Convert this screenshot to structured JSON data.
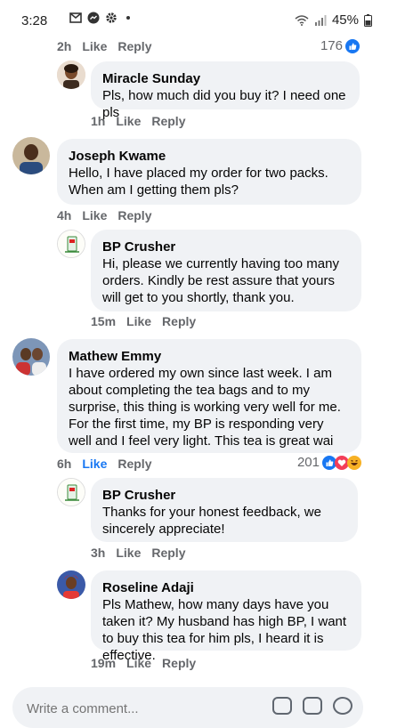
{
  "status_bar": {
    "time": "3:28",
    "battery": "45%"
  },
  "colors": {
    "like_blue": "#1877f2",
    "bubble_bg": "#f0f2f5",
    "meta_gray": "#65676b"
  },
  "reaction_icons": [
    "like-reaction-icon",
    "love-reaction-icon",
    "haha-reaction-icon"
  ],
  "comments": [
    {
      "meta": {
        "time": "2h",
        "like": "Like",
        "reply": "Reply",
        "count": "176"
      }
    },
    {
      "name": "Miracle Sunday",
      "text": "Pls, how much did you buy it? I need one pls",
      "meta": {
        "time": "1h",
        "like": "Like",
        "reply": "Reply"
      }
    },
    {
      "name": "Joseph Kwame",
      "text": "Hello, I have placed my order for two packs. When am I getting them pls?",
      "meta": {
        "time": "4h",
        "like": "Like",
        "reply": "Reply"
      }
    },
    {
      "name": "BP Crusher",
      "text": "Hi, please we currently having too many orders. Kindly be rest assure that yours will get to you shortly,  thank you.",
      "meta": {
        "time": "15m",
        "like": "Like",
        "reply": "Reply"
      }
    },
    {
      "name": "Mathew Emmy",
      "text": "I have ordered my own since last week. I am about completing the tea bags and to my surprise,  this thing is working very well for me. For the first time, my BP is responding very well and I feel very light. This tea is great wai",
      "meta": {
        "time": "6h",
        "like": "Like",
        "reply": "Reply",
        "count": "201"
      }
    },
    {
      "name": "BP Crusher",
      "text": "Thanks for your honest feedback,  we sincerely appreciate!",
      "meta": {
        "time": "3h",
        "like": "Like",
        "reply": "Reply"
      }
    },
    {
      "name": "Roseline Adaji",
      "text": "Pls Mathew, how many days have you taken it? My husband has high BP, I want to buy this tea for him pls, I heard it is effective.",
      "meta": {
        "time": "19m",
        "like": "Like",
        "reply": "Reply"
      }
    }
  ],
  "composer": {
    "placeholder": "Write a comment..."
  }
}
